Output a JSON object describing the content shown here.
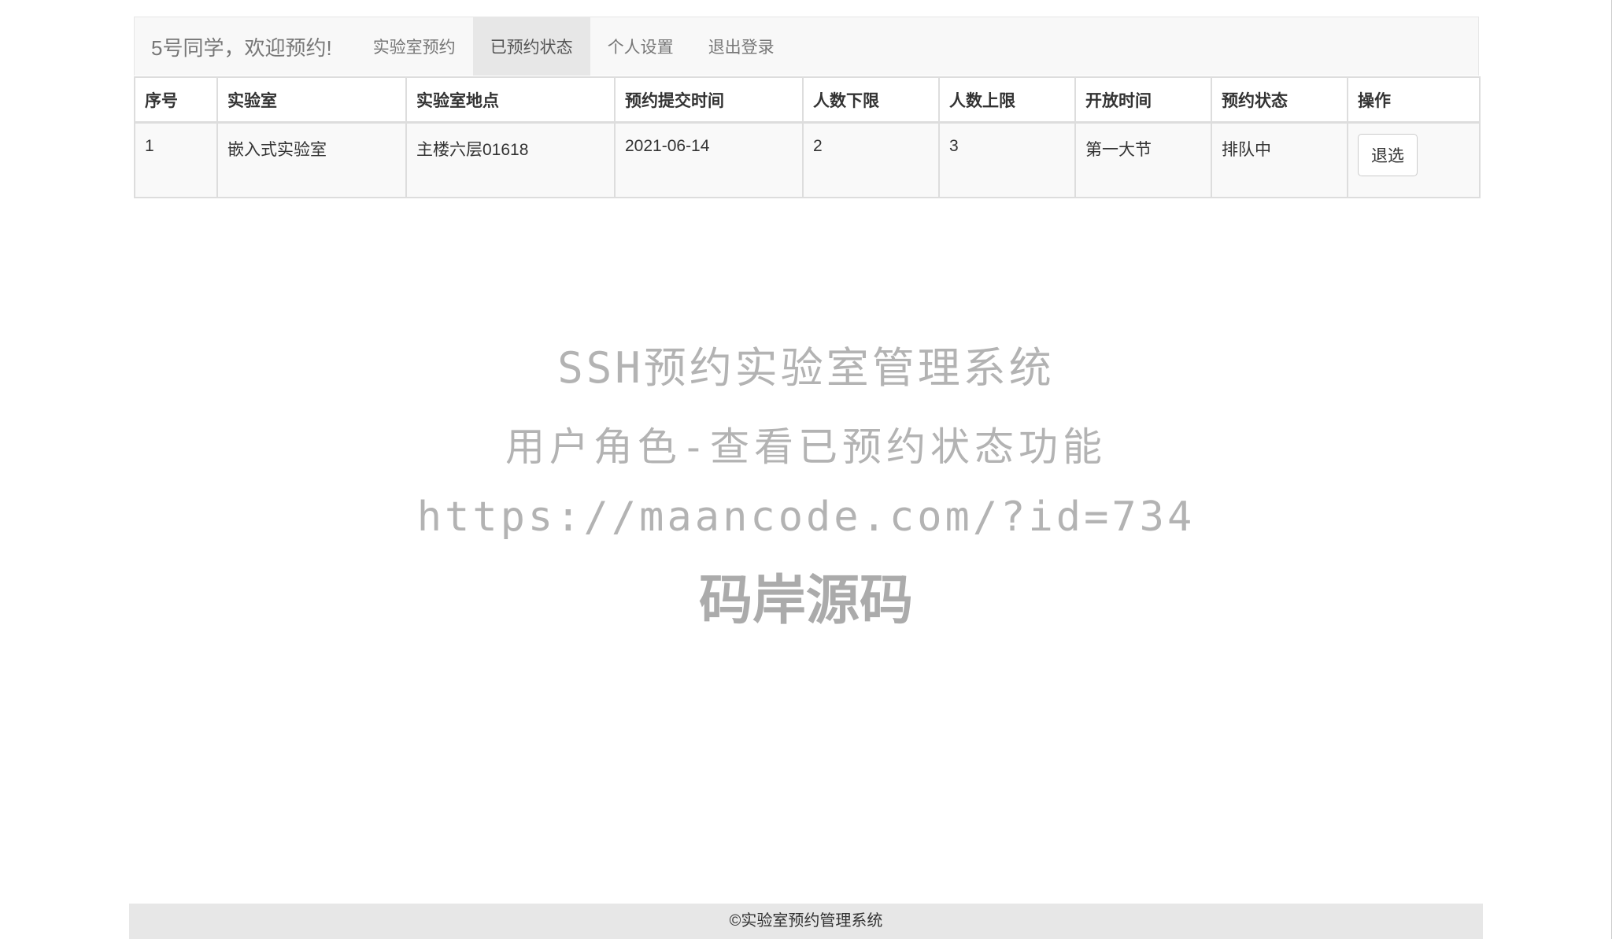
{
  "navbar": {
    "brand": "5号同学，欢迎预约!",
    "items": [
      {
        "label": "实验室预约",
        "active": false
      },
      {
        "label": "已预约状态",
        "active": true
      },
      {
        "label": "个人设置",
        "active": false
      },
      {
        "label": "退出登录",
        "active": false
      }
    ]
  },
  "table": {
    "headers": [
      "序号",
      "实验室",
      "实验室地点",
      "预约提交时间",
      "人数下限",
      "人数上限",
      "开放时间",
      "预约状态",
      "操作"
    ],
    "rows": [
      {
        "index": "1",
        "lab": "嵌入式实验室",
        "location": "主楼六层01618",
        "submit_time": "2021-06-14",
        "min_people": "2",
        "max_people": "3",
        "open_time": "第一大节",
        "status": "排队中",
        "action_label": "退选"
      }
    ]
  },
  "watermark": {
    "line1": "SSH预约实验室管理系统",
    "line2": "用户角色-查看已预约状态功能",
    "line3": "https://maancode.com/?id=734",
    "line4": "码岸源码"
  },
  "footer": {
    "text": "©实验室预约管理系统"
  },
  "colors": {
    "navbar_bg": "#f8f8f8",
    "nav_active_bg": "#e7e7e7",
    "footer_bg": "#e7e7e7",
    "watermark": "#b3b3b3"
  }
}
